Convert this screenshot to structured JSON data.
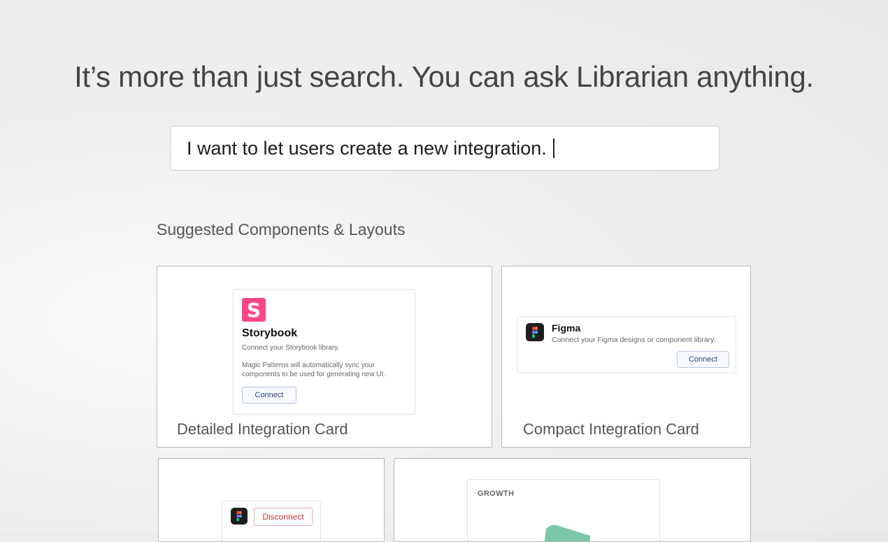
{
  "headline": "It’s more than just search. You can ask Librarian anything.",
  "search": {
    "value": "I want to let users create a new integration."
  },
  "section_title": "Suggested Components & Layouts",
  "cards": [
    {
      "label": "Detailed Integration Card",
      "preview": {
        "logo_letter": "S",
        "title": "Storybook",
        "subtitle": "Connect your Storybook library.",
        "description_line1": "Magic Patterns will automatically sync your",
        "description_line2": "components to be used for generating new UI.",
        "button": "Connect"
      }
    },
    {
      "label": "Compact Integration Card",
      "preview": {
        "title": "Figma",
        "subtitle": "Connect your Figma designs or component library.",
        "button": "Connect"
      }
    },
    {
      "preview": {
        "button": "Disconnect"
      }
    },
    {
      "preview": {
        "label": "GROWTH"
      }
    }
  ],
  "colors": {
    "storybook_pink": "#ff4785",
    "figma_red": "#f24e1e",
    "figma_orange": "#ff7262",
    "figma_purple": "#a259ff",
    "figma_blue": "#1abcfe",
    "figma_green": "#0acf83",
    "growth_teal": "#7cc7a9"
  }
}
